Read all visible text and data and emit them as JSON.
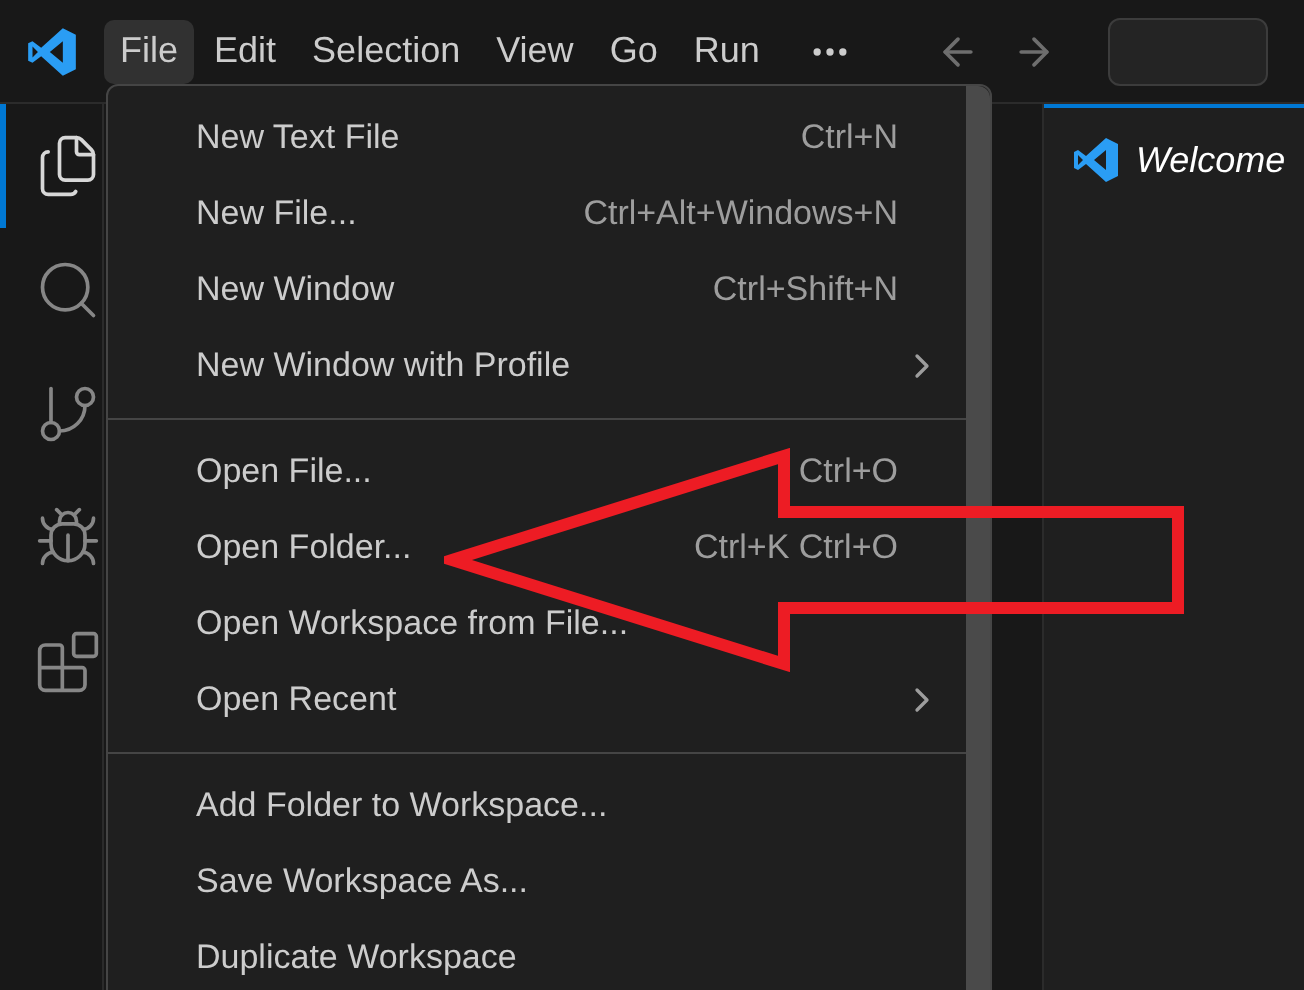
{
  "menu_bar": [
    {
      "label": "File",
      "selected": true
    },
    {
      "label": "Edit",
      "selected": false
    },
    {
      "label": "Selection",
      "selected": false
    },
    {
      "label": "View",
      "selected": false
    },
    {
      "label": "Go",
      "selected": false
    },
    {
      "label": "Run",
      "selected": false
    }
  ],
  "activity_bar": [
    {
      "kind": "explorer",
      "selected": true
    },
    {
      "kind": "search",
      "selected": false
    },
    {
      "kind": "source-control",
      "selected": false
    },
    {
      "kind": "debug",
      "selected": false
    },
    {
      "kind": "extensions",
      "selected": false
    }
  ],
  "editor_tab": {
    "label": "Welcome"
  },
  "file_menu": {
    "groups": [
      [
        {
          "label": "New Text File",
          "shortcut": "Ctrl+N"
        },
        {
          "label": "New File...",
          "shortcut": "Ctrl+Alt+Windows+N"
        },
        {
          "label": "New Window",
          "shortcut": "Ctrl+Shift+N"
        },
        {
          "label": "New Window with Profile",
          "submenu": true
        }
      ],
      [
        {
          "label": "Open File...",
          "shortcut": "Ctrl+O"
        },
        {
          "label": "Open Folder...",
          "shortcut": "Ctrl+K Ctrl+O"
        },
        {
          "label": "Open Workspace from File..."
        },
        {
          "label": "Open Recent",
          "submenu": true
        }
      ],
      [
        {
          "label": "Add Folder to Workspace..."
        },
        {
          "label": "Save Workspace As..."
        },
        {
          "label": "Duplicate Workspace"
        }
      ]
    ]
  }
}
